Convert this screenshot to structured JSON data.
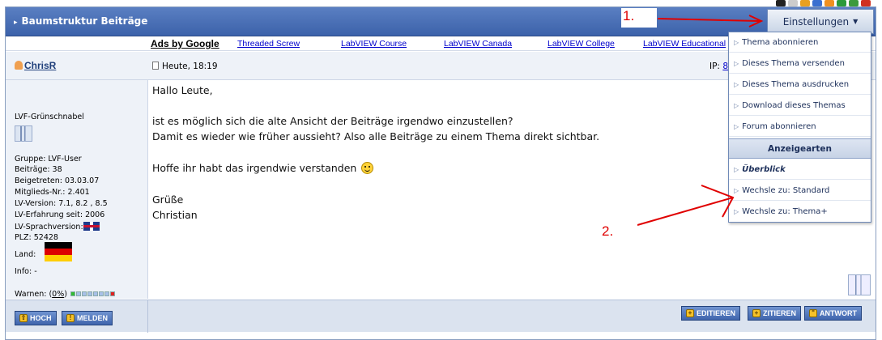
{
  "header": {
    "title": "Baumstruktur Beiträge",
    "settings_label": "Einstellungen"
  },
  "ads": {
    "title": "Ads by Google",
    "links": [
      "Threaded Screw",
      "LabVIEW Course",
      "LabVIEW Canada",
      "LabVIEW College",
      "LabVIEW Educational"
    ]
  },
  "post": {
    "username": "ChrisR",
    "date": "Heute, 18:19",
    "ip_label": "IP:",
    "ip_value": "8",
    "body": {
      "greeting": "Hallo Leute,",
      "line1": "ist es möglich sich die alte Ansicht der Beiträge irgendwo einzustellen?",
      "line2": "Damit es wieder wie früher aussieht? Also alle Beiträge zu einem Thema direkt sichtbar.",
      "line3": "Hoffe ihr habt das irgendwie verstanden",
      "closing": "Grüße",
      "signature": "Christian"
    }
  },
  "user": {
    "rank": "LVF-Grünschnabel",
    "group": "Gruppe: LVF-User",
    "posts": "Beiträge: 38",
    "joined": "Beigetreten: 03.03.07",
    "member_no": "Mitglieds-Nr.: 2.401",
    "lv_version": "LV-Version: 7.1, 8.2 , 8.5",
    "lv_experience": "LV-Erfahrung seit: 2006",
    "lv_language": "LV-Sprachversion:",
    "plz": "PLZ: 52428",
    "country": "Land:",
    "info": "Info: -",
    "warn_label": "Warnen: (",
    "warn_value": "0%",
    "warn_close": ")"
  },
  "footer": {
    "hoch": "HOCH",
    "melden": "MELDEN",
    "editieren": "EDITIEREN",
    "zitieren": "ZITIEREN",
    "antwort": "ANTWORT"
  },
  "dropdown": {
    "items": [
      "Thema abonnieren",
      "Dieses Thema versenden",
      "Dieses Thema ausdrucken",
      "Download dieses Themas",
      "Forum abonnieren"
    ],
    "section": "Anzeigearten",
    "views": [
      "Überblick",
      "Wechsle zu: Standard",
      "Wechsle zu: Thema+"
    ]
  },
  "annotations": {
    "step1": "1.",
    "step2": "2."
  },
  "colors": {
    "header_blue": "#4a70b8",
    "annotation_red": "#e00000"
  }
}
